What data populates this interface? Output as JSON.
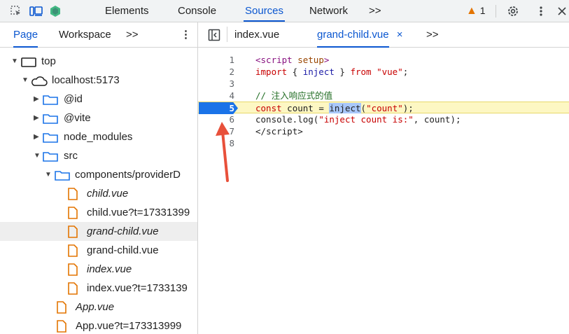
{
  "toolbar": {
    "tabs": [
      {
        "label": "Elements",
        "active": false
      },
      {
        "label": "Console",
        "active": false
      },
      {
        "label": "Sources",
        "active": true
      },
      {
        "label": "Network",
        "active": false
      }
    ],
    "more_label": ">>",
    "warning_count": "1",
    "accent_color": "#0b57d0"
  },
  "navigator": {
    "tabs": [
      {
        "label": "Page",
        "active": true
      },
      {
        "label": "Workspace",
        "active": false
      }
    ],
    "more_label": ">>",
    "tree": [
      {
        "label": "top",
        "icon": "frame-icon"
      },
      {
        "label": "localhost:5173",
        "icon": "cloud-icon"
      },
      {
        "label": "@id",
        "icon": "folder-icon"
      },
      {
        "label": "@vite",
        "icon": "folder-icon"
      },
      {
        "label": "node_modules",
        "icon": "folder-icon"
      },
      {
        "label": "src",
        "icon": "folder-icon"
      },
      {
        "label": "components/providerD",
        "icon": "folder-icon"
      },
      {
        "label": "child.vue",
        "icon": "file-icon"
      },
      {
        "label": "child.vue?t=17331399",
        "icon": "file-icon"
      },
      {
        "label": "grand-child.vue",
        "icon": "file-icon",
        "selected": true
      },
      {
        "label": "grand-child.vue",
        "icon": "file-icon"
      },
      {
        "label": "index.vue",
        "icon": "file-icon"
      },
      {
        "label": "index.vue?t=1733139",
        "icon": "file-icon"
      },
      {
        "label": "App.vue",
        "icon": "file-icon"
      },
      {
        "label": "App.vue?t=173313999",
        "icon": "file-icon"
      }
    ]
  },
  "editor": {
    "tabs": [
      {
        "label": "index.vue",
        "active": false
      },
      {
        "label": "grand-child.vue",
        "active": true
      }
    ],
    "close_label": "×",
    "more_label": ">>",
    "breakpoint_line": "5",
    "line_numbers": [
      "1",
      "2",
      "3",
      "4",
      "5",
      "6",
      "7",
      "8"
    ],
    "lines": {
      "l1": {
        "a": "<",
        "b": "script",
        "c": " ",
        "d": "setup",
        "e": ">"
      },
      "l2": {
        "a": "import",
        "b": " { ",
        "c": "inject",
        "d": " } ",
        "e": "from",
        "f": " ",
        "g": "\"vue\"",
        "h": ";"
      },
      "l4": {
        "a": "// 注入响应式的值"
      },
      "l5": {
        "a": "const",
        "b": " count = ",
        "c": "inject",
        "d": "(",
        "e": "\"count\"",
        "f": ");"
      },
      "l6": {
        "a": "console.log(",
        "b": "\"inject count is:\"",
        "c": ", count);"
      },
      "l7": {
        "a": "</",
        "b": "script",
        "c": ">"
      }
    }
  },
  "annotation": {
    "arrow_color": "#e8503a"
  }
}
